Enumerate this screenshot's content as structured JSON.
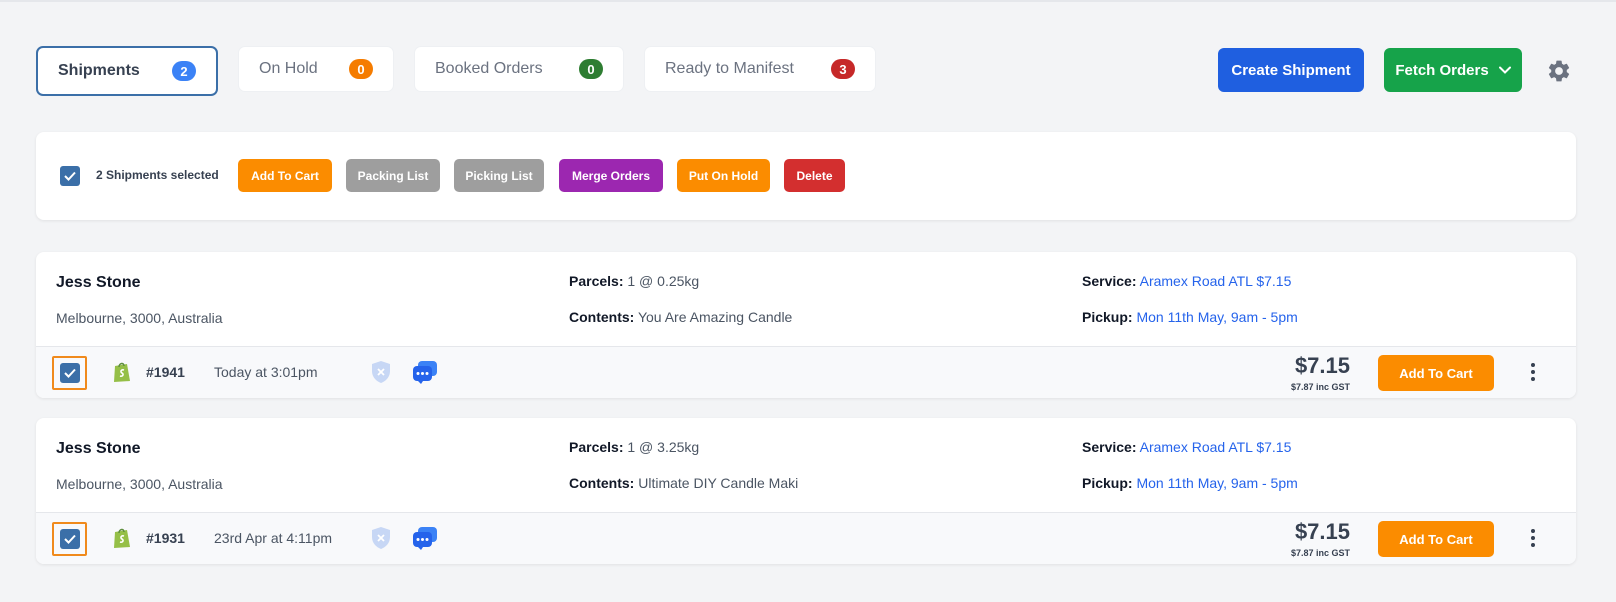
{
  "tabs": [
    {
      "label": "Shipments",
      "count": "2",
      "badge_color": "#3b82f6"
    },
    {
      "label": "On Hold",
      "count": "0",
      "badge_color": "#f57c00"
    },
    {
      "label": "Booked Orders",
      "count": "0",
      "badge_color": "#2e7d32"
    },
    {
      "label": "Ready to Manifest",
      "count": "3",
      "badge_color": "#c62828"
    }
  ],
  "header": {
    "create_label": "Create Shipment",
    "fetch_label": "Fetch Orders",
    "settings_icon": "gear-icon"
  },
  "selection": {
    "text": "2 Shipments selected",
    "actions": [
      {
        "label": "Add To Cart",
        "color": "#fb8c00"
      },
      {
        "label": "Packing List",
        "color": "#9e9e9e"
      },
      {
        "label": "Picking List",
        "color": "#9e9e9e"
      },
      {
        "label": "Merge Orders",
        "color": "#9c27b0"
      },
      {
        "label": "Put On Hold",
        "color": "#fb8c00"
      },
      {
        "label": "Delete",
        "color": "#d32f2f"
      }
    ]
  },
  "shipments": [
    {
      "name": "Jess Stone",
      "address": "Melbourne, 3000, Australia",
      "parcels_label": "Parcels:",
      "parcels": "1 @ 0.25kg",
      "contents_label": "Contents:",
      "contents": "You Are Amazing Candle",
      "service_label": "Service:",
      "service": "Aramex Road ATL $7.15",
      "pickup_label": "Pickup:",
      "pickup": "Mon 11th May, 9am - 5pm",
      "order": "#1941",
      "time": "Today at 3:01pm",
      "price": "$7.15",
      "price_gst": "$7.87 inc GST",
      "cart_label": "Add To Cart"
    },
    {
      "name": "Jess Stone",
      "address": "Melbourne, 3000, Australia",
      "parcels_label": "Parcels:",
      "parcels": "1 @ 3.25kg",
      "contents_label": "Contents:",
      "contents": "Ultimate DIY Candle Maki",
      "service_label": "Service:",
      "service": "Aramex Road ATL $7.15",
      "pickup_label": "Pickup:",
      "pickup": "Mon 11th May, 9am - 5pm",
      "order": "#1931",
      "time": "23rd Apr at 4:11pm",
      "price": "$7.15",
      "price_gst": "$7.87 inc GST",
      "cart_label": "Add To Cart"
    }
  ],
  "colors": {
    "primary_blue": "#1f5fe0",
    "fetch_green": "#16a34a",
    "link_blue": "#2563eb",
    "highlight_orange": "#f08a1c"
  }
}
